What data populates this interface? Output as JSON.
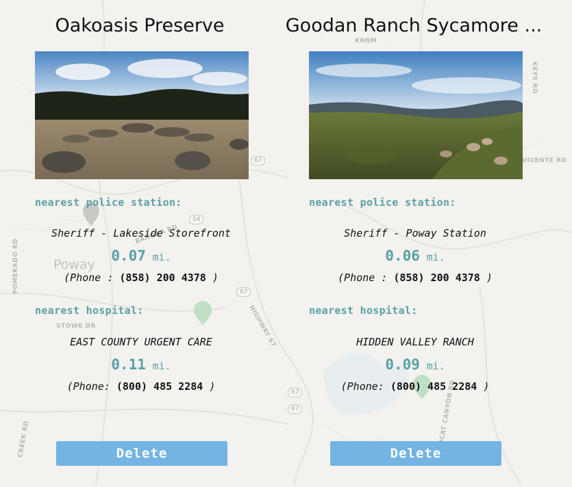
{
  "map": {
    "town_label": "Poway",
    "street_labels": [
      "KRNM",
      "KEYS RD",
      "VICENTE RD",
      "POMERADO RD",
      "STOWE DR",
      "BARONA RD",
      "HIGHWAY 67",
      "S4",
      "CREEK RD",
      "WILDCAT CANYON RD"
    ],
    "route_badges": [
      "67",
      "67",
      "67",
      "67",
      "S4"
    ]
  },
  "cards": [
    {
      "title": "Oakoasis Preserve",
      "photo_icon": "park-photo",
      "police_label": "nearest police station:",
      "police_name": "Sheriff - Lakeside Storefront",
      "police_distance": "0.07",
      "police_unit": "mi.",
      "police_phone_prefix": "(Phone : ",
      "police_phone": "(858) 200 4378",
      "police_phone_suffix": " )",
      "hospital_label": "nearest hospital:",
      "hospital_name": "EAST COUNTY URGENT CARE",
      "hospital_distance": "0.11",
      "hospital_unit": "mi.",
      "hospital_phone_prefix": "(Phone: ",
      "hospital_phone": "(800) 485 2284",
      "hospital_phone_suffix": " )",
      "delete_label": "Delete"
    },
    {
      "title": "Goodan Ranch Sycamore ...",
      "photo_icon": "ranch-photo",
      "police_label": "nearest police station:",
      "police_name": "Sheriff - Poway Station",
      "police_distance": "0.06",
      "police_unit": "mi.",
      "police_phone_prefix": "(Phone : ",
      "police_phone": "(858) 200 4378",
      "police_phone_suffix": " )",
      "hospital_label": "nearest hospital:",
      "hospital_name": "HIDDEN VALLEY RANCH",
      "hospital_distance": "0.09",
      "hospital_unit": "mi.",
      "hospital_phone_prefix": "(Phone: ",
      "hospital_phone": "(800) 485 2284",
      "hospital_phone_suffix": " )",
      "delete_label": "Delete"
    }
  ],
  "colors": {
    "accent": "#5aa0a6",
    "button": "#73b4e2"
  }
}
